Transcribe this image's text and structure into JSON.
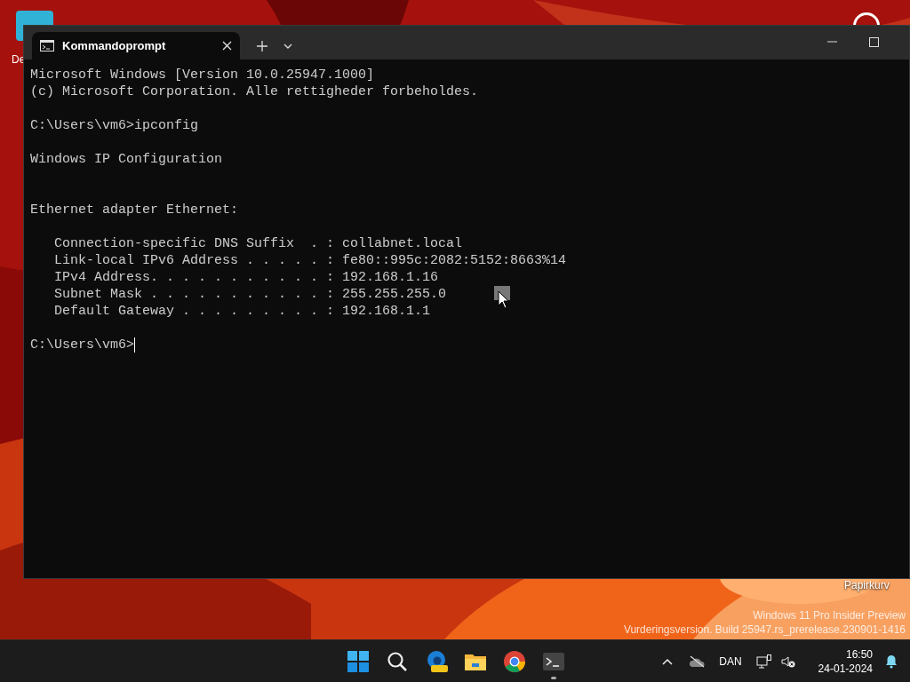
{
  "desktop": {
    "icons": [
      {
        "label": "De"
      },
      {
        "label": "Papirkurv"
      }
    ],
    "watermark": [
      "Windows 11 Pro Insider Preview",
      "Vurderingsversion. Build 25947.rs_prerelease.230901-1416"
    ]
  },
  "window": {
    "tab": {
      "title": "Kommandoprompt",
      "selected": true
    },
    "lines": [
      {
        "kind": "text",
        "text": "Microsoft Windows [Version 10.0.25947.1000]"
      },
      {
        "kind": "text",
        "text": "(c) Microsoft Corporation. Alle rettigheder forbeholdes."
      },
      {
        "kind": "blank"
      },
      {
        "kind": "text",
        "text": "C:\\Users\\vm6>ipconfig"
      },
      {
        "kind": "blank"
      },
      {
        "kind": "text",
        "text": "Windows IP Configuration"
      },
      {
        "kind": "blank"
      },
      {
        "kind": "blank"
      },
      {
        "kind": "text",
        "text": "Ethernet adapter Ethernet:"
      },
      {
        "kind": "blank"
      },
      {
        "kind": "text",
        "text": "   Connection-specific DNS Suffix  . : collabnet.local"
      },
      {
        "kind": "text",
        "text": "   Link-local IPv6 Address . . . . . : fe80::995c:2082:5152:8663%14"
      },
      {
        "kind": "text",
        "text": "   IPv4 Address. . . . . . . . . . . : 192.168.1.16"
      },
      {
        "kind": "text",
        "text": "   Subnet Mask . . . . . . . . . . . : 255.255.255.0"
      },
      {
        "kind": "text",
        "text": "   Default Gateway . . . . . . . . . : 192.168.1.1"
      },
      {
        "kind": "blank"
      },
      {
        "kind": "prompt",
        "text": "C:\\Users\\vm6>"
      }
    ]
  },
  "taskbar": {
    "apps": [
      {
        "kind": "start",
        "running": false
      },
      {
        "kind": "search",
        "running": false
      },
      {
        "kind": "edge",
        "running": false
      },
      {
        "kind": "explorer",
        "running": false
      },
      {
        "kind": "chrome",
        "running": false
      },
      {
        "kind": "terminal",
        "running": true
      }
    ],
    "tray": {
      "language": "DAN",
      "time": "16:50",
      "date": "24-01-2024"
    }
  }
}
